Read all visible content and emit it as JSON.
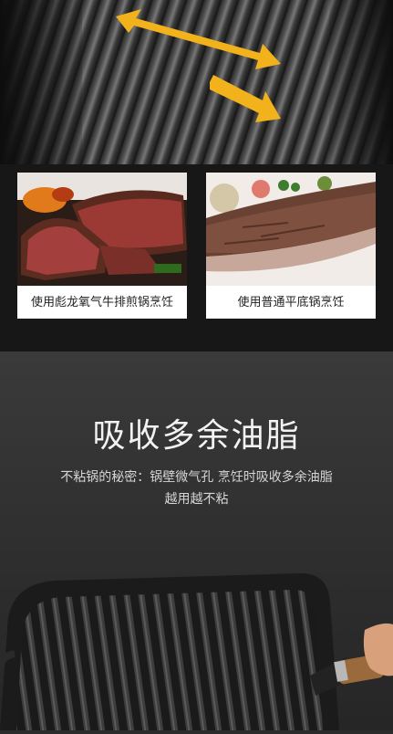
{
  "comparison": {
    "left_caption": "使用彪龙氧气牛排煎锅烹饪",
    "right_caption": "使用普通平底锅烹饪"
  },
  "feature": {
    "headline": "吸收多余油脂",
    "body_line1": "不粘锅的秘密：锅壁微气孔 烹饪时吸收多余油脂",
    "body_line2": "越用越不粘"
  },
  "icons": {
    "arrow_color": "#f2b21c"
  }
}
